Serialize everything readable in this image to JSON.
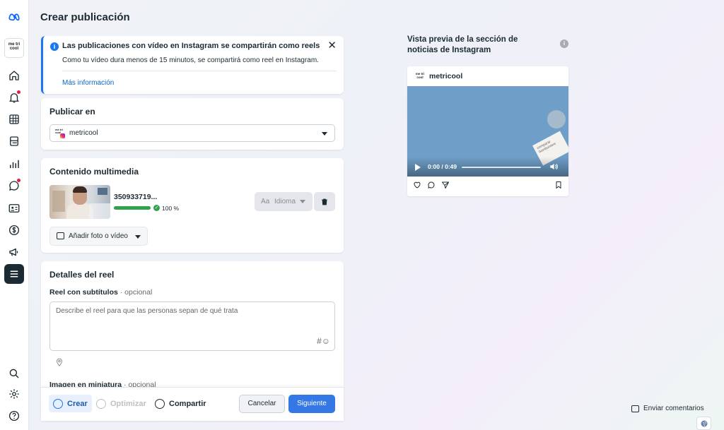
{
  "sidebar": {
    "account_logo_text": "me tri cool",
    "items": [
      {
        "icon": "home-icon",
        "notify": false
      },
      {
        "icon": "bell-icon",
        "notify": true
      },
      {
        "icon": "calendar-grid-icon",
        "notify": false
      },
      {
        "icon": "posts-icon",
        "notify": false
      },
      {
        "icon": "bar-chart-icon",
        "notify": false
      },
      {
        "icon": "chat-icon",
        "notify": true
      },
      {
        "icon": "contact-card-icon",
        "notify": false
      },
      {
        "icon": "dollar-icon",
        "notify": false
      },
      {
        "icon": "megaphone-icon",
        "notify": false
      },
      {
        "icon": "menu-icon",
        "active": true
      }
    ],
    "bottom": [
      "search-icon",
      "gear-icon",
      "help-icon"
    ]
  },
  "page": {
    "title": "Crear publicación"
  },
  "banner": {
    "title": "Las publicaciones con vídeo en Instagram se compartirán como reels",
    "body": "Como tu vídeo dura menos de 15 minutos, se compartirá como reel en Instagram.",
    "link": "Más información"
  },
  "publish": {
    "title": "Publicar en",
    "account": "metricool",
    "logo_text": "me tri cool"
  },
  "media": {
    "title": "Contenido multimedia",
    "file_name": "350933719...",
    "progress": 100,
    "progress_label": "100 %",
    "language_button": "Idioma",
    "language_prefix": "Aa",
    "add_button": "Añadir foto o vídeo"
  },
  "details": {
    "title": "Detalles del reel",
    "caption_label": "Reel con subtítulos",
    "optional": "· opcional",
    "caption_placeholder": "Describe el reel para que las personas sepan de qué trata",
    "hash_emoji": "#☺",
    "thumbnail_label": "Imagen en miniatura",
    "thumbnail_optional": "· opcional"
  },
  "footer": {
    "steps": [
      "Crear",
      "Optimizar",
      "Compartir"
    ],
    "cancel": "Cancelar",
    "next": "Siguiente"
  },
  "preview": {
    "title": "Vista previa de la sección de noticias de Instagram",
    "info_glyph": "i",
    "account": "metricool",
    "avatar_text": "me tri cool",
    "video_time": "0:00 / 0:49",
    "note_text": "comparar bomboniere"
  },
  "feedback": {
    "label": "Enviar comentarios"
  },
  "colors": {
    "accent": "#1877f2",
    "primary_button": "#3578e5",
    "success": "#31a24c",
    "sidebar_active": "#1c2b33"
  }
}
